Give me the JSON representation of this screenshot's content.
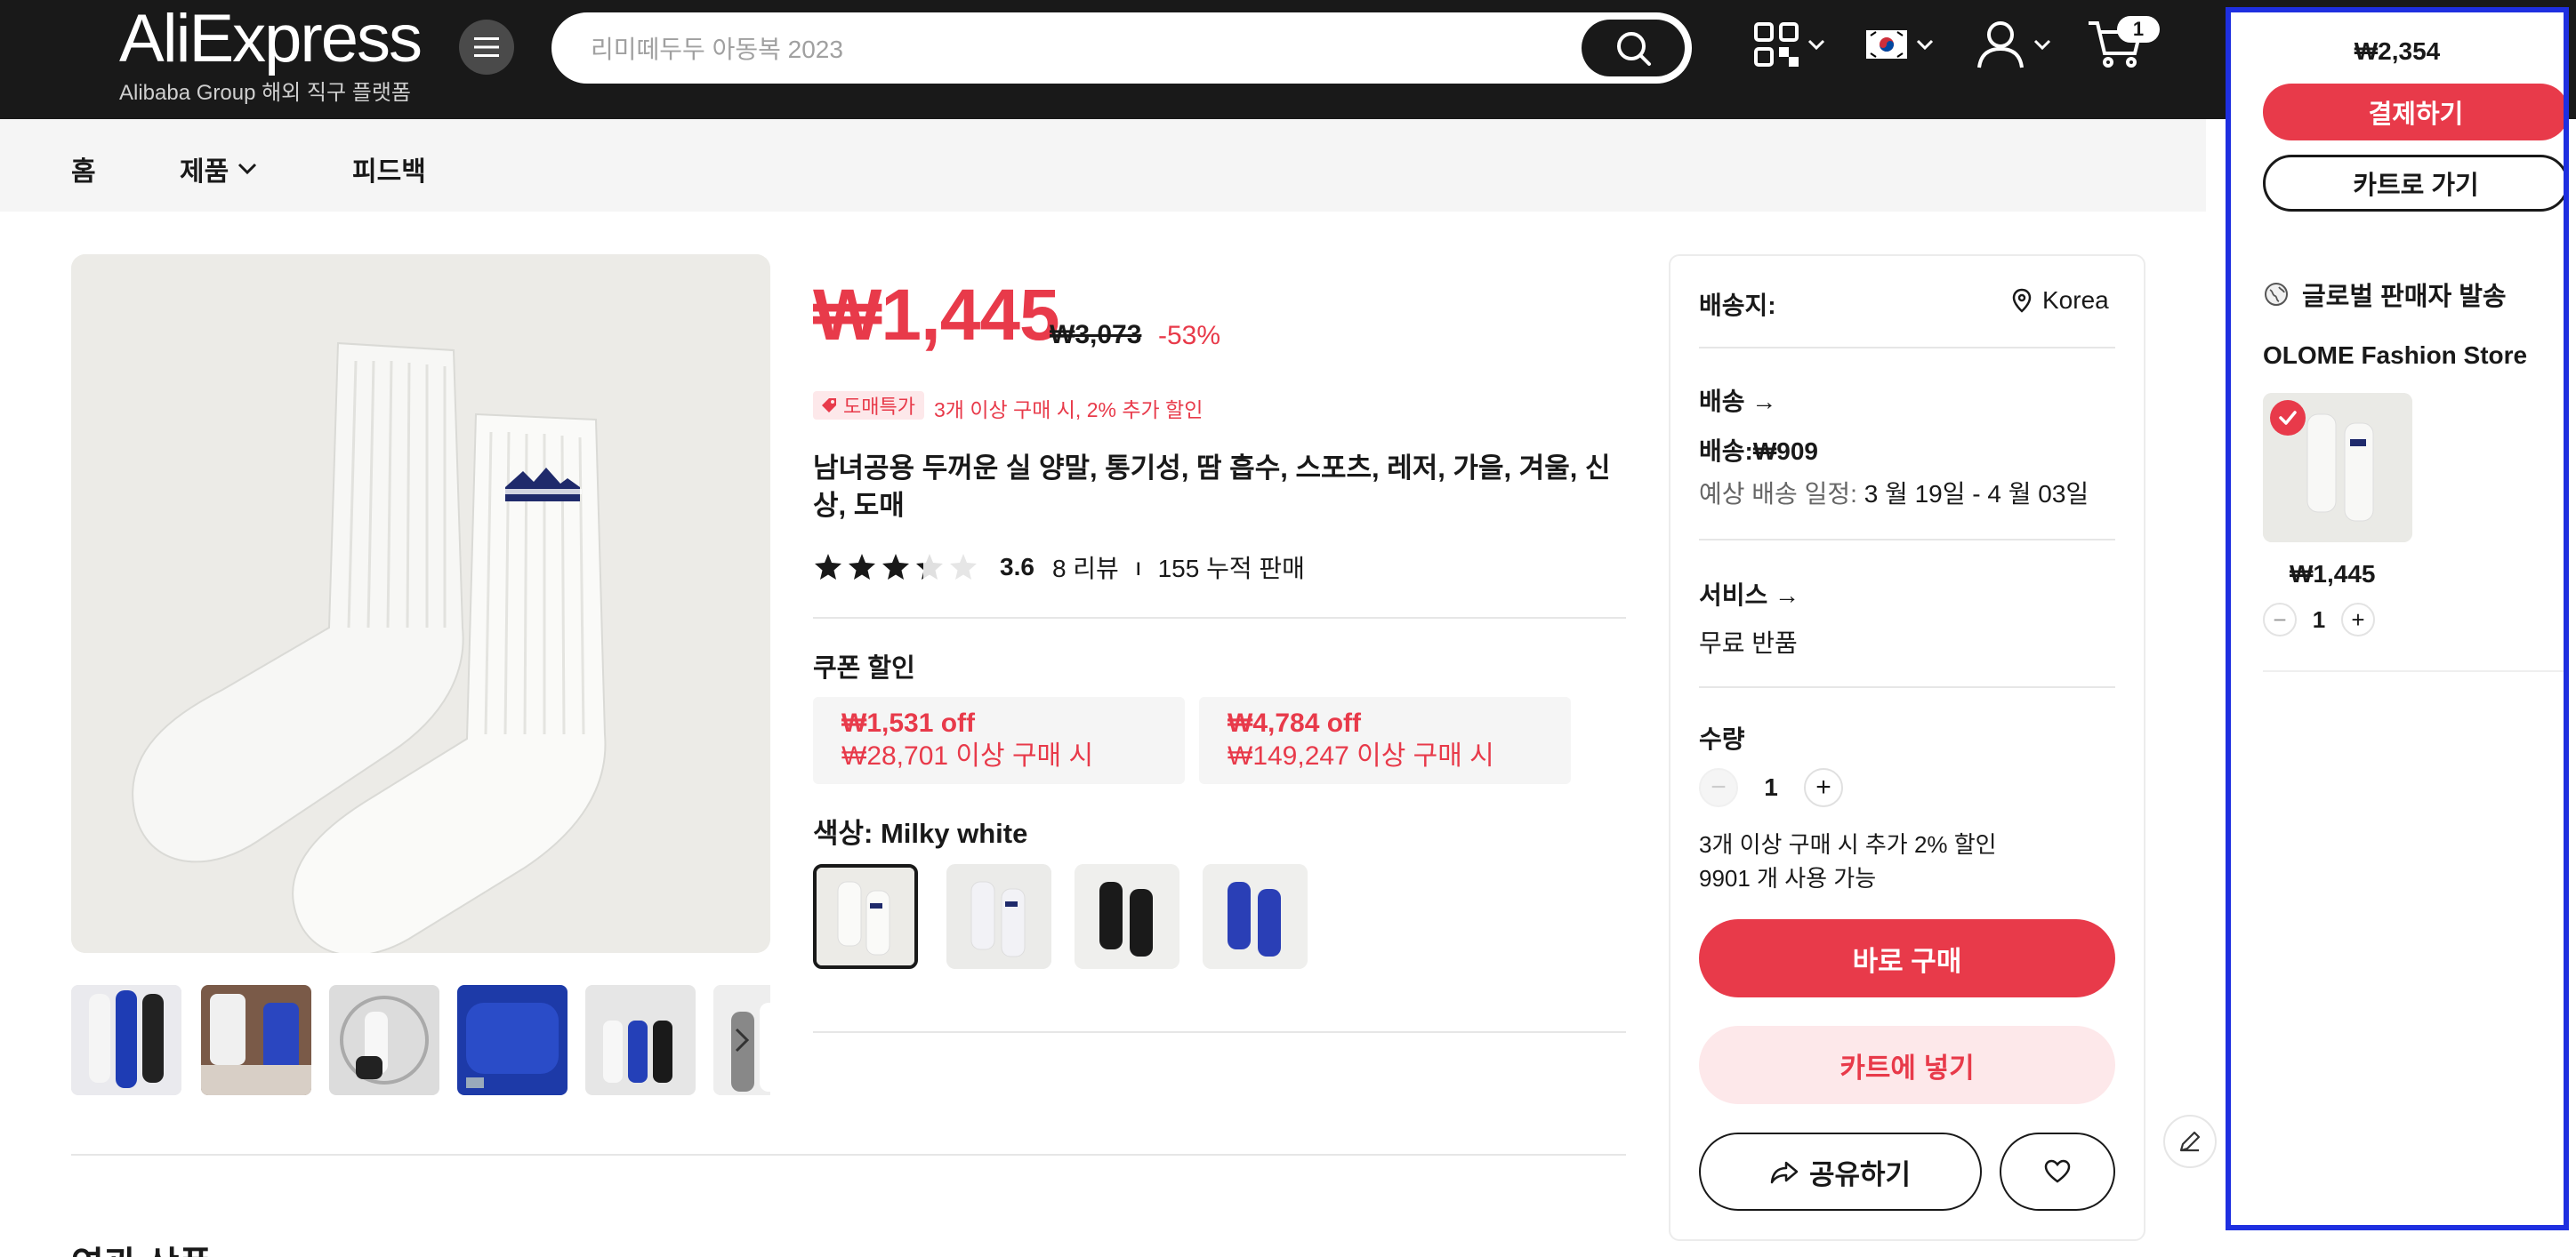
{
  "header": {
    "logo": "AliExpress",
    "logo_sub": "Alibaba Group 해외 직구 플랫폼",
    "search_placeholder": "리미떼두두 아동복 2023",
    "cart_count": "1"
  },
  "nav": {
    "items": [
      {
        "label": "홈"
      },
      {
        "label": "제품"
      },
      {
        "label": "피드백"
      }
    ]
  },
  "product": {
    "price": "₩1,445",
    "old_price": "₩3,073",
    "discount": "-53%",
    "bulk_tag": "도매특가",
    "bulk_text": "3개 이상 구매 시, 2% 추가 할인",
    "title": "남녀공용 두꺼운 실 양말, 통기성, 땀 흡수, 스포츠, 레저, 가을, 겨울, 신상, 도매",
    "rating": 3.6,
    "rating_text": "3.6",
    "reviews": "8 리뷰",
    "sold": "155 누적 판매",
    "coupon_title": "쿠폰 할인",
    "coupons": [
      {
        "off": "₩1,531 off",
        "cond": "₩28,701 이상 구매 시"
      },
      {
        "off": "₩4,784 off",
        "cond": "₩149,247 이상 구매 시"
      }
    ],
    "color_label": "색상: Milky white",
    "swatch_colors": [
      "#f3f3f0",
      "#e9e9ee",
      "#222222",
      "#2a3fb6"
    ]
  },
  "shipping": {
    "ship_to_label": "배송지:",
    "ship_to_value": "Korea",
    "delivery_label": "배송 →",
    "delivery_fee": "배송:₩909",
    "eta_label": "예상 배송 일정:",
    "eta_value": "3 월 19일 - 4 월 03일",
    "service_label": "서비스 →",
    "service_value": "무료 반품",
    "qty_label": "수량",
    "qty_value": "1",
    "bulk_note": "3개 이상 구매 시 추가 2% 할인",
    "available": "9901 개 사용 가능",
    "buy_now": "바로 구매",
    "add_cart": "카트에 넣기",
    "share": "공유하기"
  },
  "panel": {
    "total": "₩2,354",
    "checkout": "결제하기",
    "go_cart": "카트로 가기",
    "seller_label": "글로벌 판매자 발송",
    "store": "OLOME Fashion Store",
    "item_price": "₩1,445",
    "item_qty": "1"
  },
  "related_title": "연관 상품",
  "colors": {
    "accent": "#e83a4a",
    "header_bg": "#191919",
    "panel_border": "#1e2fe0"
  }
}
